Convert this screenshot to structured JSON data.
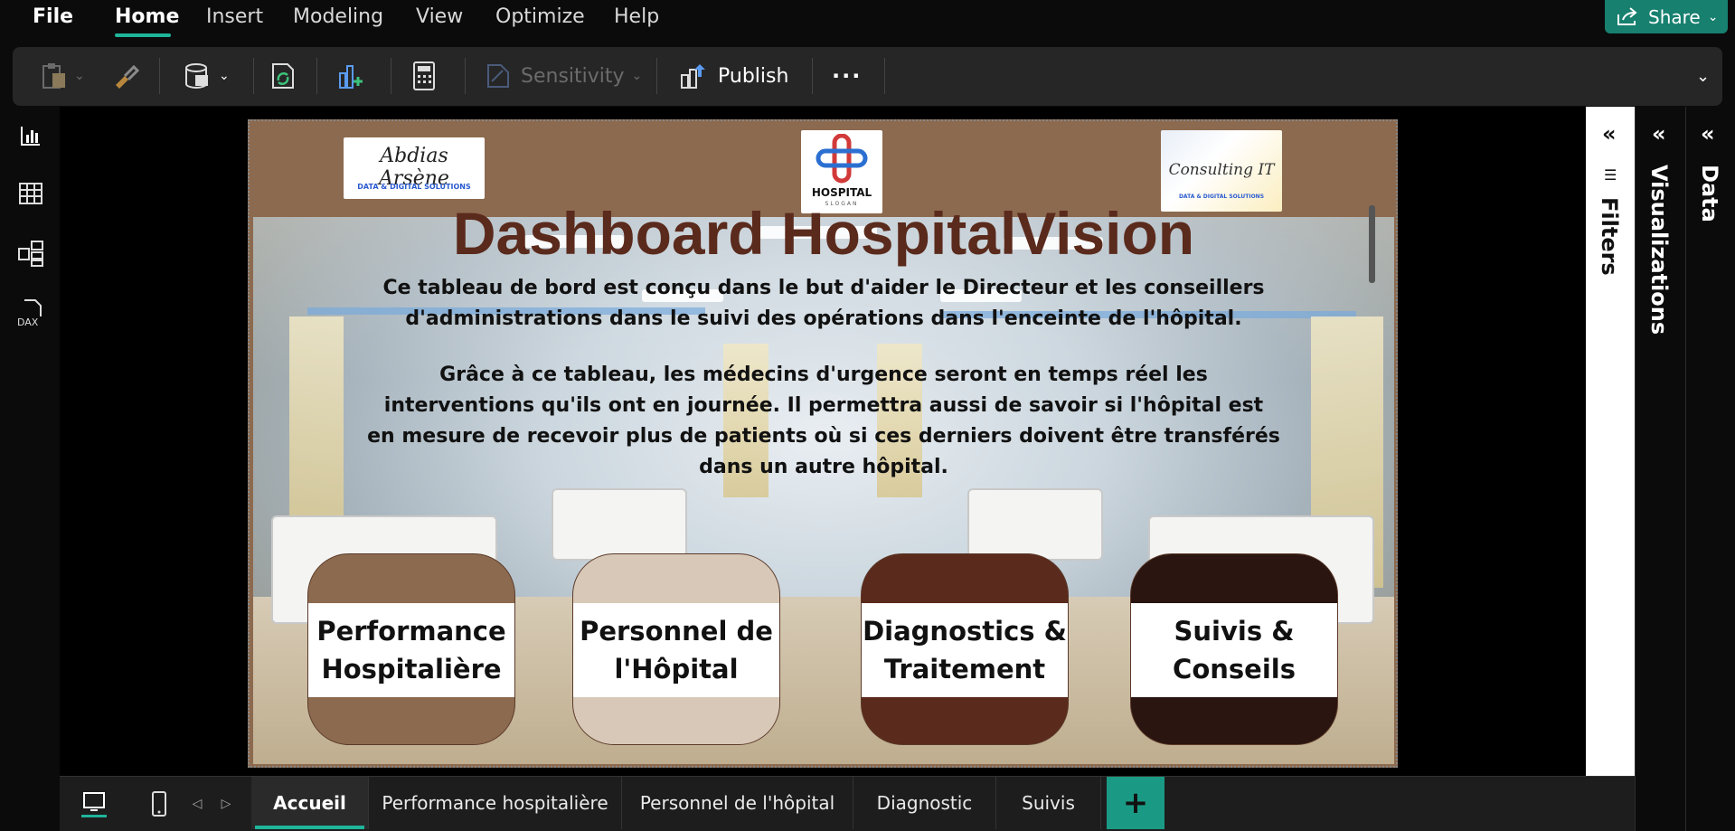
{
  "menu": {
    "file": "File",
    "tabs": [
      "Home",
      "Insert",
      "Modeling",
      "View",
      "Optimize",
      "Help"
    ],
    "active_tab": "Home",
    "share_label": "Share"
  },
  "ribbon": {
    "sensitivity_label": "Sensitivity",
    "publish_label": "Publish",
    "more_label": "···"
  },
  "left_rail": {
    "items": [
      "report-view-icon",
      "table-view-icon",
      "model-view-icon",
      "dax-query-icon"
    ],
    "dax_label": "DAX"
  },
  "report": {
    "logos": {
      "left_name": "Abdias Arsène",
      "left_tag": "DATA & DIGITAL SOLUTIONS",
      "center_name": "HOSPITAL",
      "center_tag": "SLOGAN",
      "right_name": "Consulting IT",
      "right_tag": "DATA & DIGITAL SOLUTIONS"
    },
    "title": "Dashboard HospitalVision",
    "paragraph_1": "Ce tableau de bord est conçu dans le but d'aider le Directeur et les conseillers d'administrations dans le suivi des opérations dans l'enceinte de l'hôpital.",
    "paragraph_2": "Grâce à ce tableau, les médecins d'urgence seront en temps réel les interventions qu'ils ont en journée. Il permettra aussi de savoir si l'hôpital est en mesure de recevoir plus de patients où si ces derniers doivent être transférés dans un autre hôpital.",
    "cards": [
      {
        "label": "Performance Hospitalière",
        "color": "#8c6a4f"
      },
      {
        "label": "Personnel de l'Hôpital",
        "color": "#d8c8b8"
      },
      {
        "label": "Diagnostics & Traitement",
        "color": "#5a2a1c"
      },
      {
        "label": "Suivis & Conseils",
        "color": "#2a1510"
      }
    ]
  },
  "panes": {
    "filters": "Filters",
    "visualizations": "Visualizations",
    "data": "Data"
  },
  "pages": {
    "tabs": [
      "Accueil",
      "Performance hospitalière",
      "Personnel de l'hôpital",
      "Diagnostic",
      "Suivis"
    ],
    "active": "Accueil",
    "add_label": "+"
  },
  "colors": {
    "accent": "#1fb59b",
    "header_brown": "#8c6a4f",
    "title_brown": "#5a2a1c"
  }
}
